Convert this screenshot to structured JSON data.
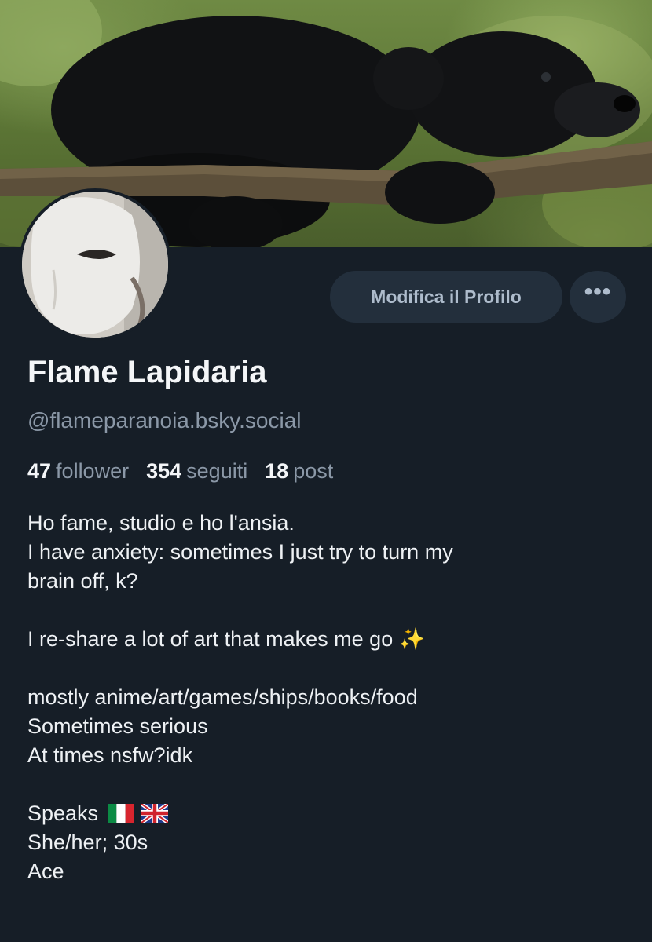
{
  "profile": {
    "display_name": "Flame Lapidaria",
    "handle": "@flameparanoia.bsky.social",
    "edit_button_label": "Modifica il Profilo",
    "more_button_label": "•••",
    "banner_subject": "black bear cub resting on a mossy branch",
    "avatar_subject": "white theatre mask"
  },
  "stats": {
    "followers_count": "47",
    "followers_label": "follower",
    "following_count": "354",
    "following_label": "seguiti",
    "posts_count": "18",
    "posts_label": "post"
  },
  "bio": {
    "line1": "Ho fame, studio e ho l'ansia.",
    "line2": "I have anxiety: sometimes I just try to turn my",
    "line3": "brain off, k?",
    "line4": "I re-share a lot of art that makes me go ✨",
    "line5": "mostly anime/art/games/ships/books/food",
    "line6": "Sometimes serious",
    "line7": "At times nsfw?idk",
    "line8": "Speaks",
    "line9": "She/her; 30s",
    "line10": "Ace"
  },
  "colors": {
    "background": "#161e27",
    "button_bg": "#232f3c",
    "muted_text": "#8b98a7",
    "primary_text": "#f4f6f8"
  }
}
